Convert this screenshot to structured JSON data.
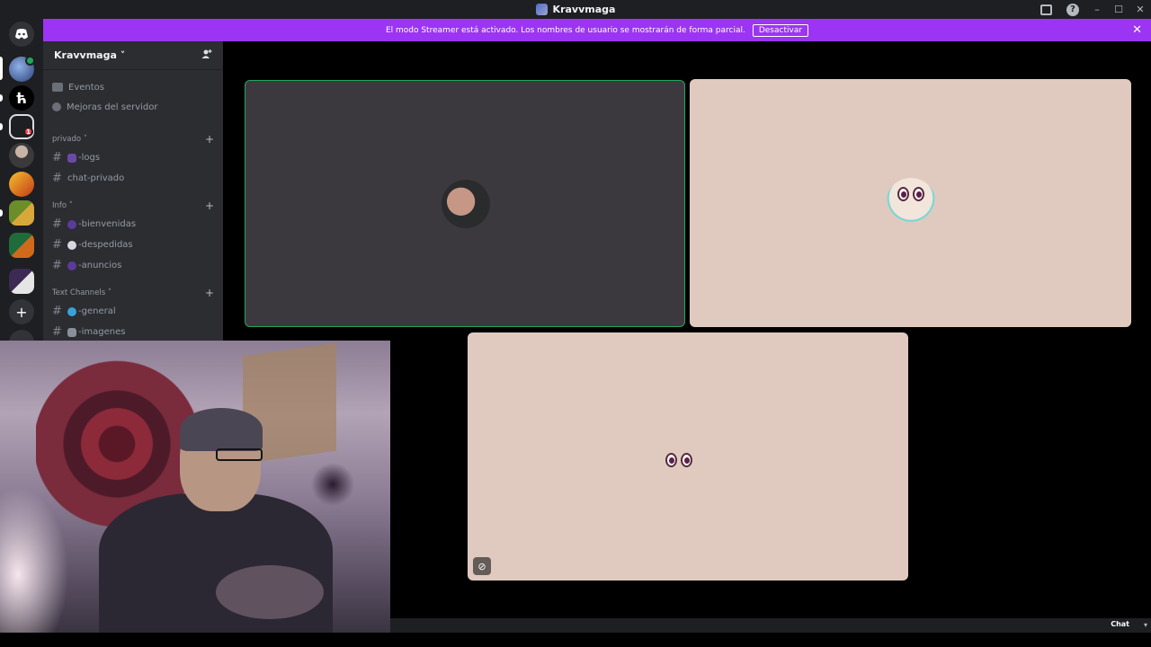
{
  "window": {
    "title": "Kravvmaga",
    "minimize": "–",
    "maximize": "☐",
    "close": "✕"
  },
  "banner": {
    "message": "El modo Streamer está activado. Los nombres de usuario se mostrarán de forma parcial.",
    "button": "Desactivar",
    "close": "✕"
  },
  "guilds": {
    "badge_1": "1"
  },
  "server": {
    "name": "Kravvmaga ˅"
  },
  "nav": [
    {
      "label": "Eventos"
    },
    {
      "label": "Mejoras del servidor"
    }
  ],
  "categories": [
    {
      "label": "privado ˅",
      "channels": [
        {
          "label": "-logs"
        },
        {
          "label": "chat-privado"
        }
      ]
    },
    {
      "label": "Info ˅",
      "channels": [
        {
          "label": "-bienvenidas"
        },
        {
          "label": "-despedidas"
        },
        {
          "label": "-anuncios"
        }
      ]
    },
    {
      "label": "Text Channels ˅",
      "channels": [
        {
          "label": "-general"
        },
        {
          "label": "-imagenes"
        }
      ]
    }
  ],
  "footer": {
    "chat_label": "Chat",
    "chat_arrow": "▾"
  },
  "colors": {
    "streamer_banner": "#9b35f3",
    "speaking_border": "#23a55a",
    "tile_beige": "#e0cac0",
    "tile_dark": "#3c393e"
  }
}
